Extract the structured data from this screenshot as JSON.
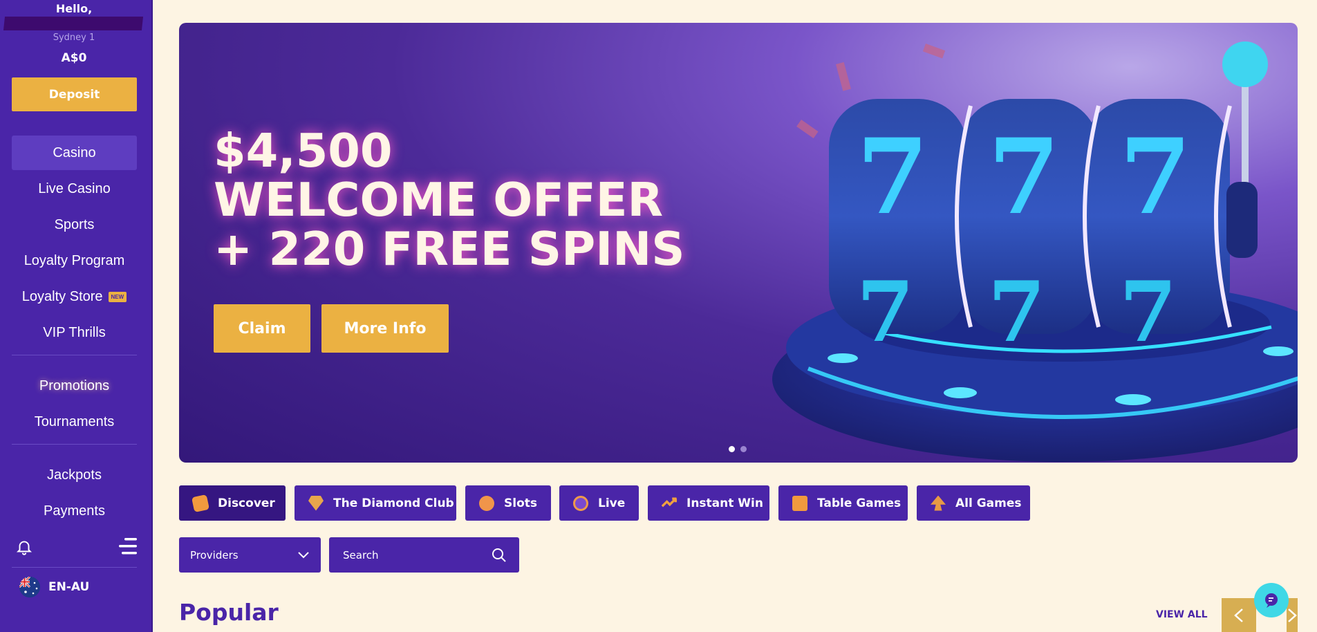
{
  "sidebar": {
    "greeting": "Hello,",
    "level": "Sydney 1",
    "balance": "A$0",
    "deposit_label": "Deposit",
    "items": [
      {
        "label": "Casino",
        "active": true
      },
      {
        "label": "Live Casino"
      },
      {
        "label": "Sports"
      },
      {
        "label": "Loyalty Program"
      },
      {
        "label": "Loyalty Store",
        "badge": "NEW"
      },
      {
        "label": "VIP Thrills"
      },
      {
        "label": "Promotions"
      },
      {
        "label": "Tournaments"
      },
      {
        "label": "Jackpots"
      },
      {
        "label": "Payments"
      }
    ],
    "language": "EN-AU"
  },
  "hero": {
    "line1": "$4,500",
    "line2": "WELCOME OFFER",
    "line3": "+ 220 FREE SPINS",
    "claim_label": "Claim",
    "more_info_label": "More Info",
    "slides": 2,
    "active_slide": 1
  },
  "categories": [
    {
      "label": "Discover",
      "icon": "discover-icon",
      "active": true
    },
    {
      "label": "The Diamond Club",
      "icon": "diamond-icon"
    },
    {
      "label": "Slots",
      "icon": "slots-icon"
    },
    {
      "label": "Live",
      "icon": "live-icon"
    },
    {
      "label": "Instant Win",
      "icon": "instant-win-icon"
    },
    {
      "label": "Table Games",
      "icon": "table-games-icon"
    },
    {
      "label": "All Games",
      "icon": "all-games-icon"
    }
  ],
  "filters": {
    "providers_label": "Providers",
    "search_placeholder": "Search"
  },
  "section": {
    "title": "Popular",
    "view_all": "VIEW ALL"
  },
  "colors": {
    "primary": "#4a25a8",
    "accent": "#ebb142",
    "background": "#fdf4e3",
    "chat": "#3fd8e6"
  }
}
